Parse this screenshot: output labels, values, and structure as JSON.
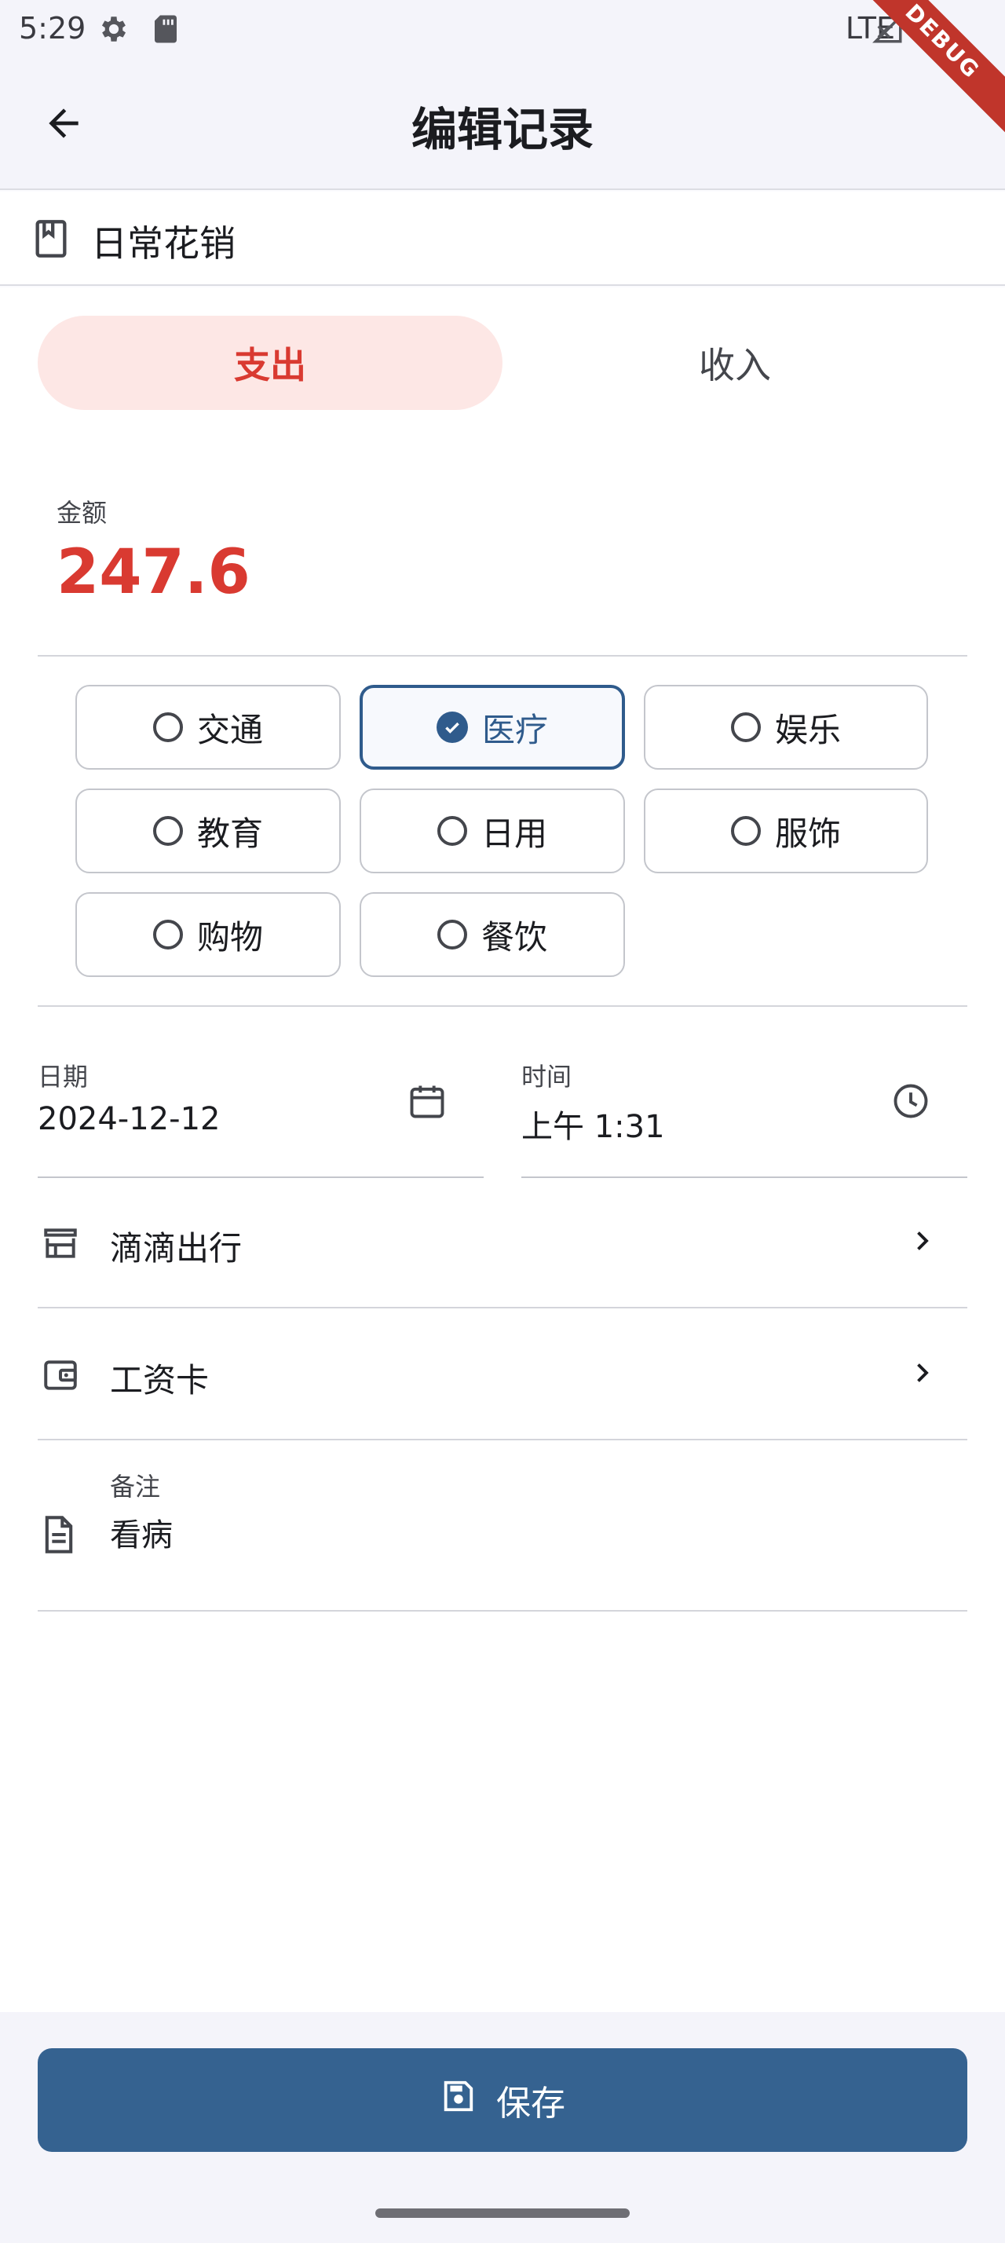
{
  "status_bar": {
    "time": "5:29",
    "network": "LTE"
  },
  "debug_banner": "DEBUG",
  "app_bar": {
    "title": "编辑记录"
  },
  "ledger": {
    "name": "日常花销"
  },
  "type_toggle": {
    "expense_label": "支出",
    "income_label": "收入",
    "selected": "expense"
  },
  "amount": {
    "label": "金额",
    "value": "247.6"
  },
  "categories": [
    {
      "label": "交通",
      "selected": false
    },
    {
      "label": "医疗",
      "selected": true
    },
    {
      "label": "娱乐",
      "selected": false
    },
    {
      "label": "教育",
      "selected": false
    },
    {
      "label": "日用",
      "selected": false
    },
    {
      "label": "服饰",
      "selected": false
    },
    {
      "label": "购物",
      "selected": false
    },
    {
      "label": "餐饮",
      "selected": false
    }
  ],
  "date_field": {
    "label": "日期",
    "value": "2024-12-12"
  },
  "time_field": {
    "label": "时间",
    "value": "上午 1:31"
  },
  "merchant": {
    "label": "滴滴出行"
  },
  "account": {
    "label": "工资卡"
  },
  "note": {
    "label": "备注",
    "value": "看病"
  },
  "save_button": {
    "label": "保存"
  },
  "colors": {
    "accent": "#356290",
    "expense": "#d93a31",
    "expense_bg": "#fde7e5"
  }
}
